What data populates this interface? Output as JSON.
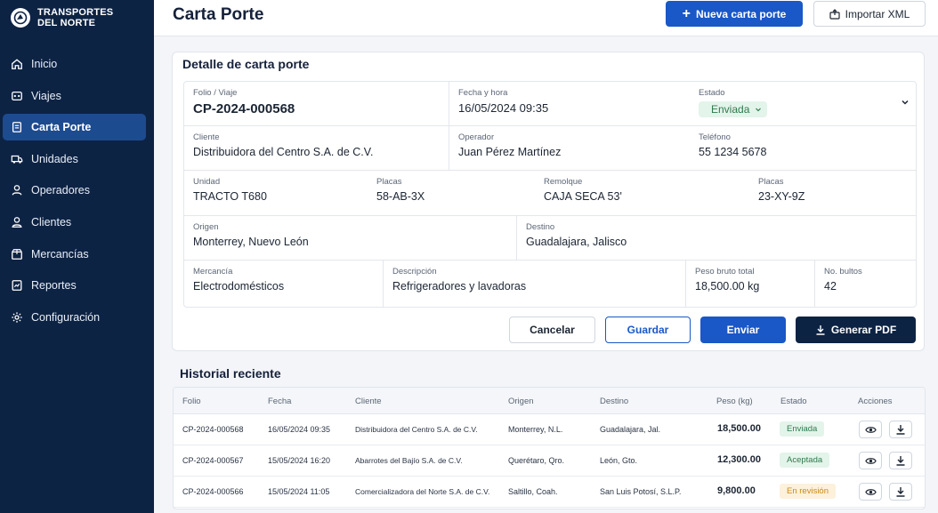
{
  "brand": {
    "line1": "TRANSPORTES",
    "line2": "DEL NORTE"
  },
  "nav": [
    {
      "label": "Inicio",
      "icon": "home-icon"
    },
    {
      "label": "Viajes",
      "icon": "route-icon"
    },
    {
      "label": "Carta Porte",
      "icon": "document-icon",
      "active": true
    },
    {
      "label": "Unidades",
      "icon": "truck-icon"
    },
    {
      "label": "Operadores",
      "icon": "user-icon"
    },
    {
      "label": "Clientes",
      "icon": "client-icon"
    },
    {
      "label": "Mercancías",
      "icon": "box-icon"
    },
    {
      "label": "Reportes",
      "icon": "report-icon"
    },
    {
      "label": "Configuración",
      "icon": "gear-icon"
    }
  ],
  "header": {
    "title": "Carta Porte",
    "new_label": "Nueva carta porte",
    "import_label": "Importar XML"
  },
  "detail": {
    "title": "Detalle de carta porte",
    "folio_label": "Folio / Viaje",
    "folio": "CP-2024-000568",
    "fecha_label": "Fecha y hora",
    "fecha": "16/05/2024 09:35",
    "estado_label": "Estado",
    "estado": "Enviada",
    "cliente_label": "Cliente",
    "cliente": "Distribuidora del Centro S.A. de C.V.",
    "operador_label": "Operador",
    "operador": "Juan Pérez Martínez",
    "telefono_label": "Teléfono",
    "telefono": "55 1234 5678",
    "unidad_label": "Unidad",
    "unidad": "TRACTO T680",
    "placas1_label": "Placas",
    "placas1": "58-AB-3X",
    "remolque_label": "Remolque",
    "remolque": "CAJA SECA 53'",
    "placas2_label": "Placas",
    "placas2": "23-XY-9Z",
    "origen_label": "Origen",
    "origen": "Monterrey, Nuevo León",
    "destino_label": "Destino",
    "destino": "Guadalajara, Jalisco",
    "mercancia_label": "Mercancía",
    "mercancia": "Electrodomésticos",
    "descripcion_label": "Descripción",
    "descripcion": "Refrigeradores y lavadoras",
    "peso_label": "Peso bruto total",
    "peso": "18,500.00 kg",
    "bultos_label": "No. bultos",
    "bultos": "42"
  },
  "actions": {
    "cancel": "Cancelar",
    "save": "Guardar",
    "send": "Enviar",
    "pdf": "Generar PDF"
  },
  "history": {
    "title": "Historial reciente",
    "columns": [
      "Folio",
      "Fecha",
      "Cliente",
      "Origen",
      "Destino",
      "Peso (kg)",
      "Estado",
      "Acciones"
    ],
    "rows": [
      {
        "folio": "CP-2024-000568",
        "fecha": "16/05/2024 09:35",
        "cliente": "Distribuidora del Centro S.A. de C.V.",
        "origen": "Monterrey, N.L.",
        "destino": "Guadalajara, Jal.",
        "peso": "18,500.00",
        "estado": "Enviada",
        "estado_bg": "#e3f4ea",
        "estado_fg": "#2f7a4d"
      },
      {
        "folio": "CP-2024-000567",
        "fecha": "15/05/2024 16:20",
        "cliente": "Abarrotes del Bajío S.A. de C.V.",
        "origen": "Querétaro, Qro.",
        "destino": "León, Gto.",
        "peso": "12,300.00",
        "estado": "Aceptada",
        "estado_bg": "#e3f4ea",
        "estado_fg": "#2f7a4d"
      },
      {
        "folio": "CP-2024-000566",
        "fecha": "15/05/2024 11:05",
        "cliente": "Comercializadora del Norte S.A. de C.V.",
        "origen": "Saltillo, Coah.",
        "destino": "San Luis Potosí, S.L.P.",
        "peso": "9,800.00",
        "estado": "En revisión",
        "estado_bg": "#fdf1dc",
        "estado_fg": "#c88a16"
      }
    ]
  },
  "colors": {
    "sidebar": "#0d2344",
    "active": "#1d4b8f",
    "primary": "#1a57c7",
    "dark_button": "#0d2344"
  }
}
